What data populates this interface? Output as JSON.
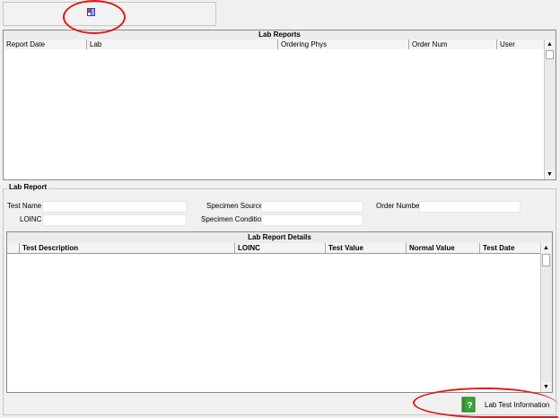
{
  "toolbar": {
    "icon": "toolbar-action-icon"
  },
  "lab_reports": {
    "title": "Lab Reports",
    "columns": [
      "Report Date",
      "Lab",
      "Ordering Phys",
      "Order Num",
      "User"
    ],
    "rows": []
  },
  "lab_report": {
    "group_title": "Lab Report",
    "test_name_label": "Test Name:",
    "test_name_value": "",
    "specimen_source_label": "Specimen Source:",
    "specimen_source_value": "",
    "order_number_label": "Order Number:",
    "order_number_value": "",
    "loinc_label": "LOINC:",
    "loinc_value": "",
    "specimen_condition_label": "Specimen Condition:",
    "specimen_condition_value": ""
  },
  "lab_report_details": {
    "title": "Lab Report Details",
    "columns": [
      "Test Description",
      "LOINC",
      "Test Value",
      "Normal Value",
      "Test Date"
    ],
    "rows": []
  },
  "lab_test_info": {
    "label": "Lab Test Information",
    "icon": "help-book-icon",
    "color": "#3aa63a"
  },
  "annotation_color": "#e01818"
}
